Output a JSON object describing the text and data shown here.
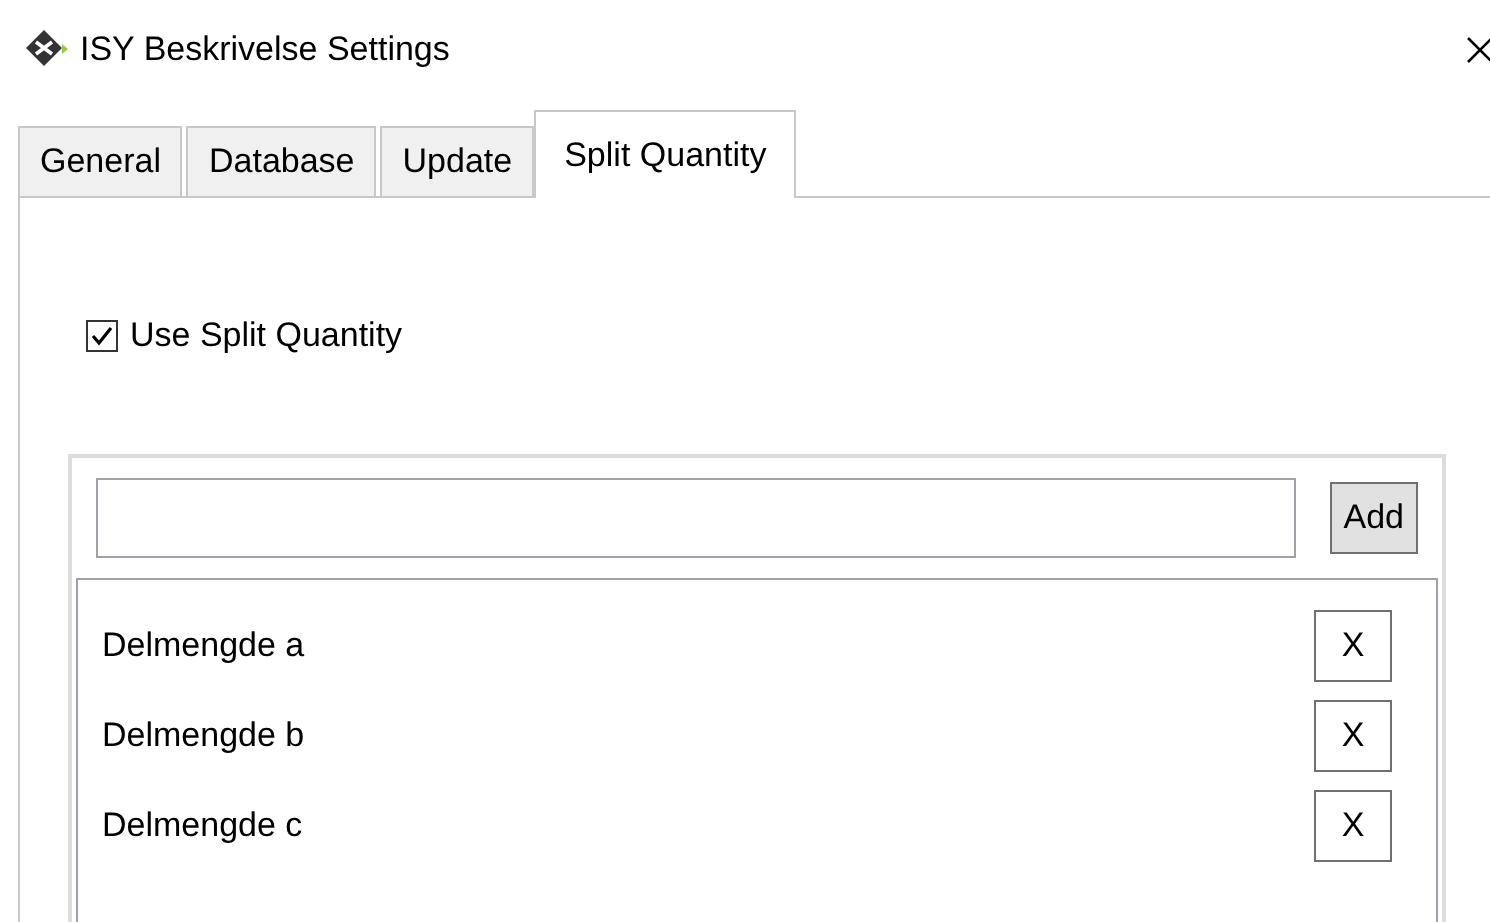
{
  "window": {
    "title": "ISY Beskrivelse Settings"
  },
  "tabs": [
    {
      "label": "General",
      "selected": false
    },
    {
      "label": "Database",
      "selected": false
    },
    {
      "label": "Update",
      "selected": false
    },
    {
      "label": "Split Quantity",
      "selected": true
    }
  ],
  "use_split_quantity": {
    "label": "Use Split Quantity",
    "checked": true
  },
  "add_button": "Add",
  "items": [
    {
      "label": "Delmengde a",
      "remove": "X"
    },
    {
      "label": "Delmengde b",
      "remove": "X"
    },
    {
      "label": "Delmengde c",
      "remove": "X"
    }
  ]
}
